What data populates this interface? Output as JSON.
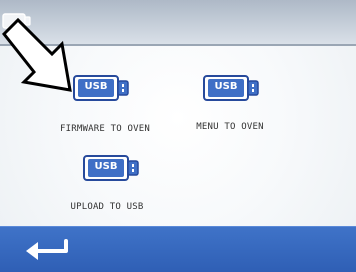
{
  "topbar": {
    "usb_icon": "usb-drive-icon"
  },
  "options": [
    {
      "id": "firmware",
      "label": "FIRMWARE TO OVEN",
      "button_text": "USB"
    },
    {
      "id": "menu",
      "label": "MENU TO OVEN",
      "button_text": "USB"
    },
    {
      "id": "upload",
      "label": "UPLOAD TO USB",
      "button_text": "USB"
    }
  ],
  "colors": {
    "icon_fill": "#3f6fc6",
    "icon_border": "#274a9c",
    "bottombar": "#3a6ac1",
    "arrow": "#ffffff"
  },
  "bottombar": {
    "back_icon": "back-arrow-icon"
  }
}
